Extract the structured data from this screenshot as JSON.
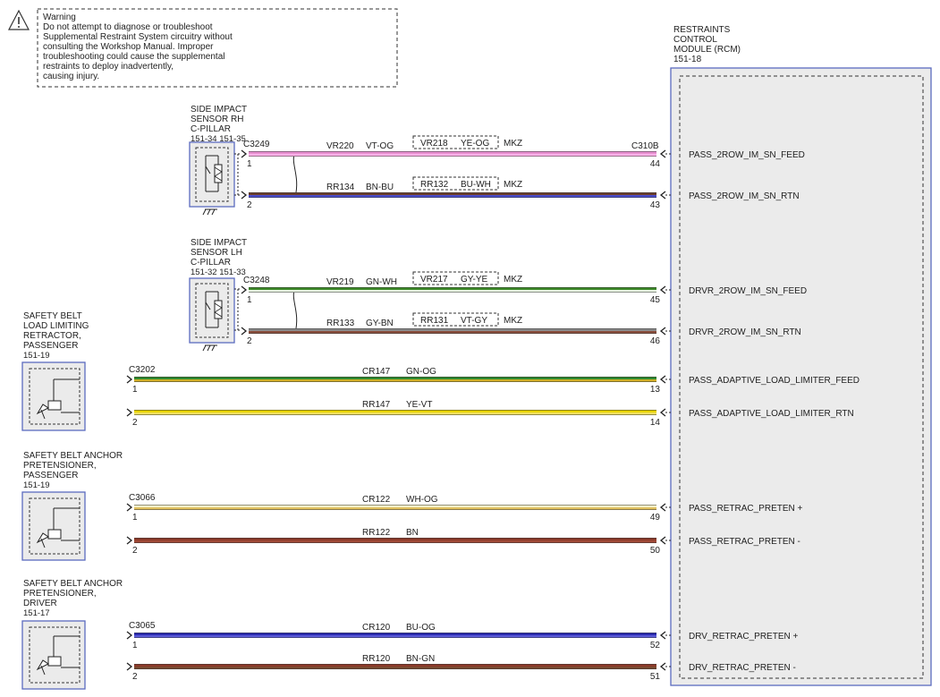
{
  "warning": {
    "lines": [
      "Warning",
      "Do not attempt to diagnose or troubleshoot",
      "Supplemental Restraint System circuitry without",
      "consulting the Workshop Manual. Improper",
      "troubleshooting could cause the supplemental",
      "restraints to deploy inadvertently,",
      "causing injury."
    ]
  },
  "rcm": {
    "lines": [
      "RESTRAINTS",
      "CONTROL",
      "MODULE (RCM)",
      "151-18"
    ],
    "connector": "C310B",
    "pins": [
      {
        "num": "44",
        "signal": "PASS_2ROW_IM_SN_FEED"
      },
      {
        "num": "43",
        "signal": "PASS_2ROW_IM_SN_RTN"
      },
      {
        "num": "45",
        "signal": "DRVR_2ROW_IM_SN_FEED"
      },
      {
        "num": "46",
        "signal": "DRVR_2ROW_IM_SN_RTN"
      },
      {
        "num": "13",
        "signal": "PASS_ADAPTIVE_LOAD_LIMITER_FEED"
      },
      {
        "num": "14",
        "signal": "PASS_ADAPTIVE_LOAD_LIMITER_RTN"
      },
      {
        "num": "49",
        "signal": "PASS_RETRAC_PRETEN +"
      },
      {
        "num": "50",
        "signal": "PASS_RETRAC_PRETEN -"
      },
      {
        "num": "52",
        "signal": "DRV_RETRAC_PRETEN +"
      },
      {
        "num": "51",
        "signal": "DRV_RETRAC_PRETEN -"
      }
    ]
  },
  "components": [
    {
      "lines": [
        "SIDE IMPACT",
        "SENSOR RH",
        "C-PILLAR",
        "151-34  151-35"
      ],
      "connector": "C3249",
      "pins": [
        "1",
        "2"
      ]
    },
    {
      "lines": [
        "SIDE IMPACT",
        "SENSOR LH",
        "C-PILLAR",
        "151-32  151-33"
      ],
      "connector": "C3248",
      "pins": [
        "1",
        "2"
      ]
    },
    {
      "lines": [
        "SAFETY BELT",
        "LOAD LIMITING",
        "RETRACTOR,",
        "PASSENGER",
        "151-19"
      ],
      "connector": "C3202",
      "pins": [
        "1",
        "2"
      ]
    },
    {
      "lines": [
        "SAFETY BELT ANCHOR",
        "PRETENSIONER,",
        "PASSENGER",
        "151-19"
      ],
      "connector": "C3066",
      "pins": [
        "1",
        "2"
      ]
    },
    {
      "lines": [
        "SAFETY BELT ANCHOR",
        "PRETENSIONER,",
        "DRIVER",
        "151-17"
      ],
      "connector": "C3065",
      "pins": [
        "1",
        "2"
      ]
    }
  ],
  "wires": [
    {
      "circuit": "VR220",
      "color_code": "VT-OG",
      "alt_circuit": "VR218",
      "alt_color": "YE-OG",
      "variant": "MKZ",
      "colors": [
        "#e88fd0",
        "#ffb0e8"
      ]
    },
    {
      "circuit": "RR134",
      "color_code": "BN-BU",
      "alt_circuit": "RR132",
      "alt_color": "BU-WH",
      "variant": "MKZ",
      "colors": [
        "#6a3d2c",
        "#4a4ac8"
      ]
    },
    {
      "circuit": "VR219",
      "color_code": "GN-WH",
      "alt_circuit": "VR217",
      "alt_color": "GY-YE",
      "variant": "MKZ",
      "colors": [
        "#3d8a2a",
        "#e6f2e0"
      ]
    },
    {
      "circuit": "RR133",
      "color_code": "GY-BN",
      "alt_circuit": "RR131",
      "alt_color": "VT-GY",
      "variant": "MKZ",
      "colors": [
        "#8a8a8a",
        "#8a4e3c"
      ]
    },
    {
      "circuit": "CR147",
      "color_code": "GN-OG",
      "colors": [
        "#2f8a2f",
        "#d0b028"
      ]
    },
    {
      "circuit": "RR147",
      "color_code": "YE-VT",
      "colors": [
        "#e8d400",
        "#f0e060"
      ]
    },
    {
      "circuit": "CR122",
      "color_code": "WH-OG",
      "colors": [
        "#f5f0c8",
        "#e0c060"
      ]
    },
    {
      "circuit": "RR122",
      "color_code": "BN",
      "colors": [
        "#8c3a2a",
        "#a04a38"
      ]
    },
    {
      "circuit": "CR120",
      "color_code": "BU-OG",
      "colors": [
        "#2a2ab0",
        "#5a5ad8"
      ]
    },
    {
      "circuit": "RR120",
      "color_code": "BN-GN",
      "colors": [
        "#8c3a2a",
        "#7a4a30"
      ]
    }
  ]
}
